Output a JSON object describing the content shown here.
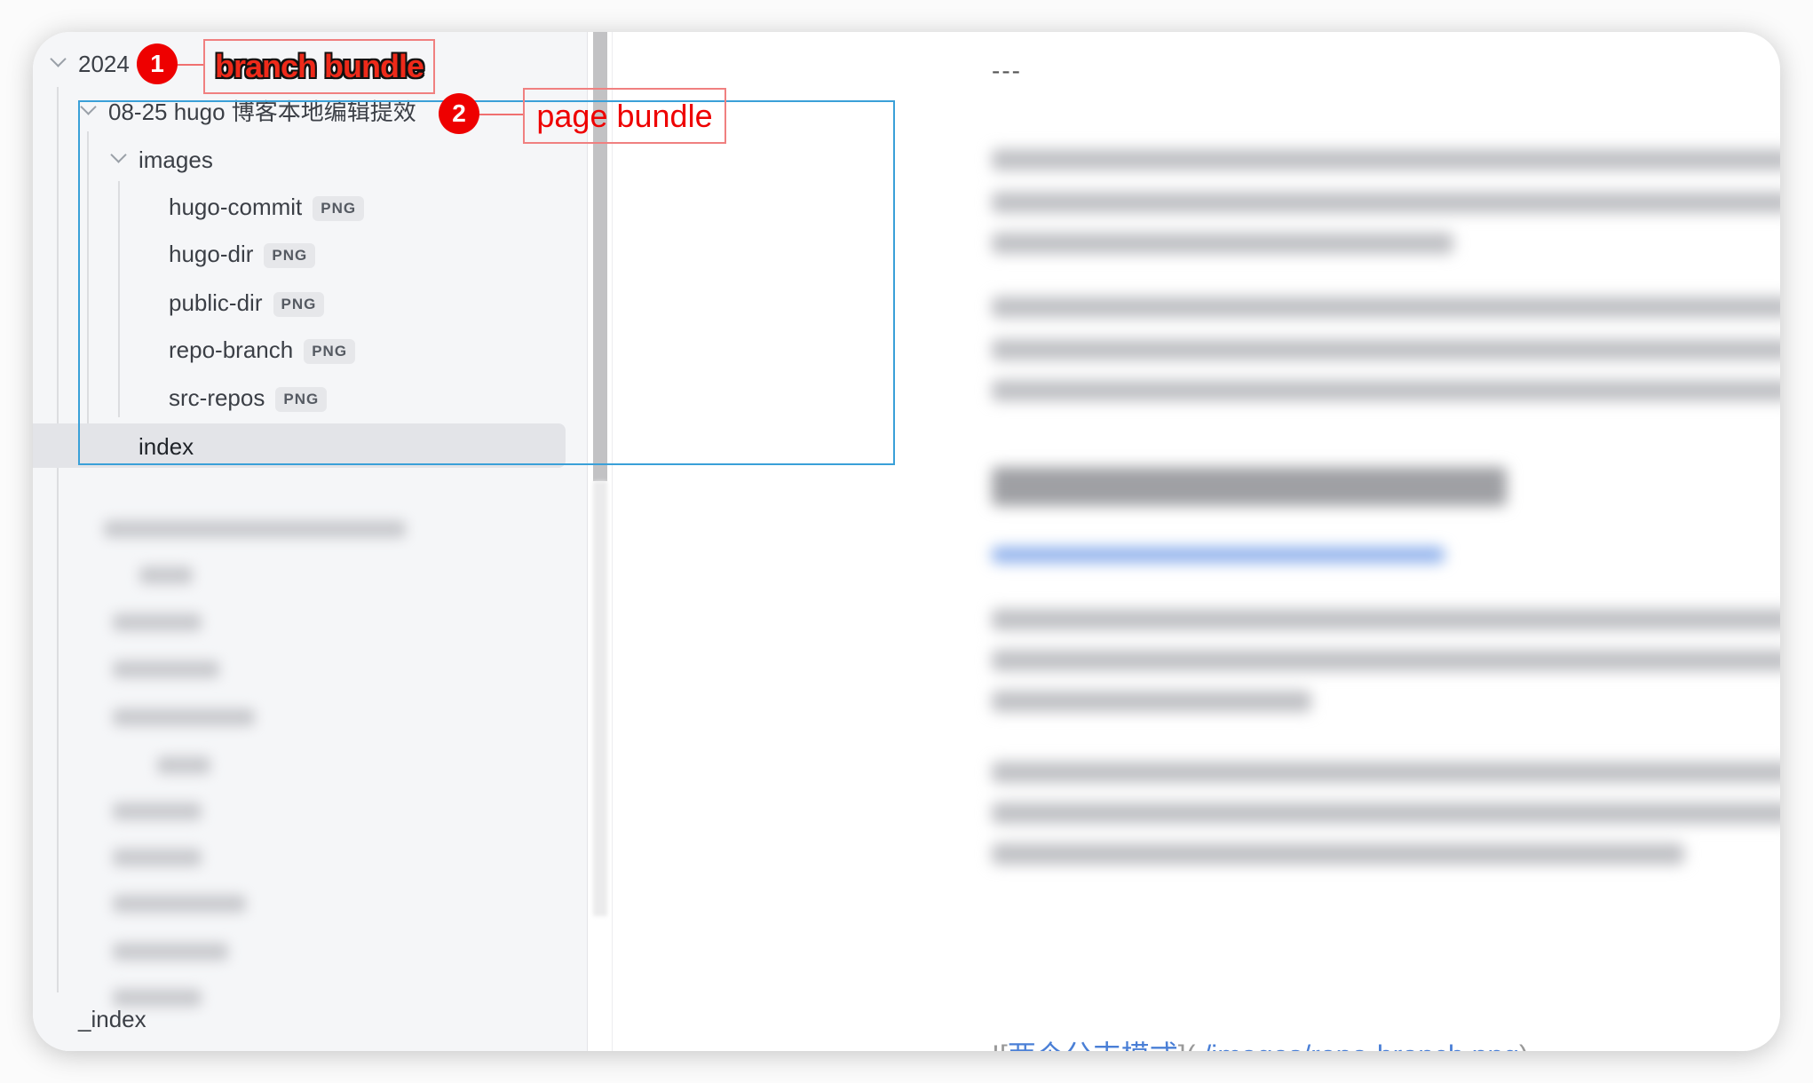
{
  "sidebar": {
    "tree": {
      "year": "2024",
      "post": "08-25 hugo 博客本地编辑提效",
      "images_folder": "images",
      "files": [
        {
          "name": "hugo-commit",
          "type": "PNG"
        },
        {
          "name": "hugo-dir",
          "type": "PNG"
        },
        {
          "name": "public-dir",
          "type": "PNG"
        },
        {
          "name": "repo-branch",
          "type": "PNG"
        },
        {
          "name": "src-repos",
          "type": "PNG"
        }
      ],
      "index": "index",
      "root_index": "_index"
    }
  },
  "annotations": {
    "branch": {
      "number": "1",
      "label": "branch bundle"
    },
    "page": {
      "number": "2",
      "label": "page bundle"
    },
    "colors": {
      "annotation": "#ee0000",
      "box": "#3aa0d8"
    }
  },
  "content": {
    "front_matter_delimiter": "---",
    "image_link_alt": "两个分支模式",
    "image_link_path": "./images/repo-branch.png"
  }
}
